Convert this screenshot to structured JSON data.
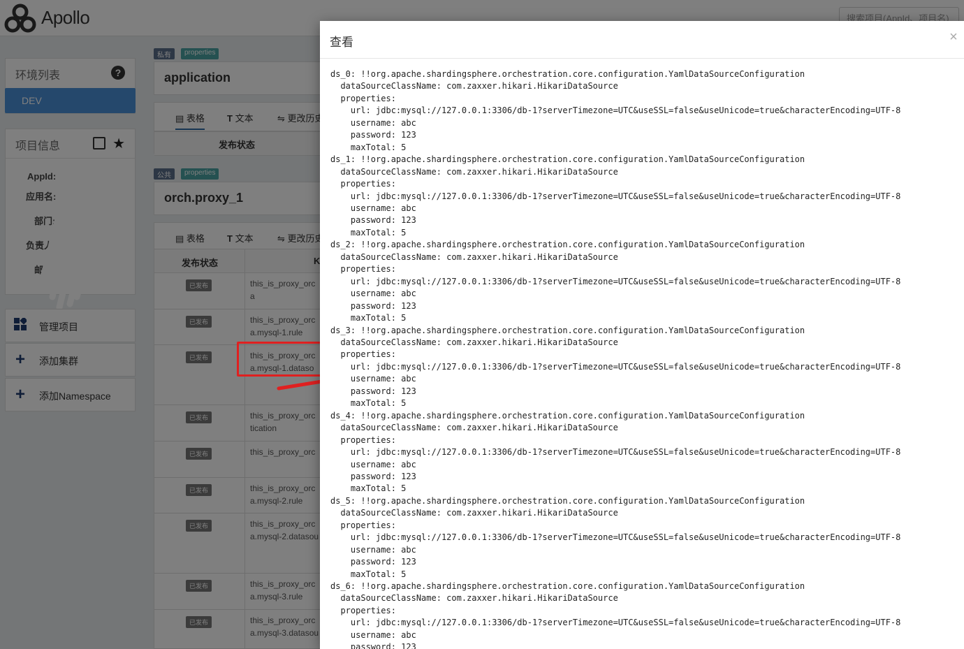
{
  "app": {
    "name": "Apollo"
  },
  "search": {
    "placeholder": "搜索项目(AppId、项目名)"
  },
  "sidebar": {
    "env_title": "环境列表",
    "env_items": [
      "DEV"
    ],
    "project_info_title": "项目信息",
    "info_labels": [
      "AppId:",
      "应用名:",
      "部门:",
      "负责人",
      "邮"
    ],
    "actions": [
      {
        "label": "管理项目",
        "icon": "grid-icon"
      },
      {
        "label": "添加集群",
        "icon": "plus-icon"
      },
      {
        "label": "添加Namespace",
        "icon": "plus-icon"
      }
    ]
  },
  "namespaces": [
    {
      "badge_scope": "私有",
      "badge_format": "properties",
      "title": "application",
      "tabs": [
        "表格",
        "文本",
        "更改历史"
      ],
      "column_status": "发布状态"
    },
    {
      "badge_scope": "公共",
      "badge_format": "properties",
      "title": "orch.proxy_1",
      "tabs": [
        "表格",
        "文本",
        "更改历史"
      ],
      "column_status": "发布状态",
      "column_key": "K"
    }
  ],
  "rows": [
    {
      "status": "已发布",
      "key1": "this_is_proxy_orc",
      "key2": "a"
    },
    {
      "status": "已发布",
      "key1": "this_is_proxy_orc",
      "key2": "a.mysql-1.rule"
    },
    {
      "status": "已发布",
      "key1": "this_is_proxy_orc",
      "key2": "a.mysql-1.dataso"
    },
    {
      "status": "已发布",
      "key1": "this_is_proxy_orc",
      "key2": "tication"
    },
    {
      "status": "已发布",
      "key1": "this_is_proxy_orc",
      "key2": ""
    },
    {
      "status": "已发布",
      "key1": "this_is_proxy_orc",
      "key2": "a.mysql-2.rule"
    },
    {
      "status": "已发布",
      "key1": "this_is_proxy_orc",
      "key2": "a.mysql-2.datasou"
    },
    {
      "status": "已发布",
      "key1": "this_is_proxy_orc",
      "key2": "a.mysql-3.rule"
    },
    {
      "status": "已发布",
      "key1": "this_is_proxy_orc",
      "key2": "a.mysql-3.datasou"
    }
  ],
  "modal": {
    "title": "查看",
    "close": "×",
    "lines": [
      "ds_0: !!org.apache.shardingsphere.orchestration.core.configuration.YamlDataSourceConfiguration",
      "  dataSourceClassName: com.zaxxer.hikari.HikariDataSource",
      "  properties:",
      "    url: jdbc:mysql://127.0.0.1:3306/db-1?serverTimezone=UTC&useSSL=false&useUnicode=true&characterEncoding=UTF-8",
      "    username: abc",
      "    password: 123",
      "    maxTotal: 5",
      "ds_1: !!org.apache.shardingsphere.orchestration.core.configuration.YamlDataSourceConfiguration",
      "  dataSourceClassName: com.zaxxer.hikari.HikariDataSource",
      "  properties:",
      "    url: jdbc:mysql://127.0.0.1:3306/db-1?serverTimezone=UTC&useSSL=false&useUnicode=true&characterEncoding=UTF-8",
      "    username: abc",
      "    password: 123",
      "    maxTotal: 5",
      "ds_2: !!org.apache.shardingsphere.orchestration.core.configuration.YamlDataSourceConfiguration",
      "  dataSourceClassName: com.zaxxer.hikari.HikariDataSource",
      "  properties:",
      "    url: jdbc:mysql://127.0.0.1:3306/db-1?serverTimezone=UTC&useSSL=false&useUnicode=true&characterEncoding=UTF-8",
      "    username: abc",
      "    password: 123",
      "    maxTotal: 5",
      "ds_3: !!org.apache.shardingsphere.orchestration.core.configuration.YamlDataSourceConfiguration",
      "  dataSourceClassName: com.zaxxer.hikari.HikariDataSource",
      "  properties:",
      "    url: jdbc:mysql://127.0.0.1:3306/db-1?serverTimezone=UTC&useSSL=false&useUnicode=true&characterEncoding=UTF-8",
      "    username: abc",
      "    password: 123",
      "    maxTotal: 5",
      "ds_4: !!org.apache.shardingsphere.orchestration.core.configuration.YamlDataSourceConfiguration",
      "  dataSourceClassName: com.zaxxer.hikari.HikariDataSource",
      "  properties:",
      "    url: jdbc:mysql://127.0.0.1:3306/db-1?serverTimezone=UTC&useSSL=false&useUnicode=true&characterEncoding=UTF-8",
      "    username: abc",
      "    password: 123",
      "    maxTotal: 5",
      "ds_5: !!org.apache.shardingsphere.orchestration.core.configuration.YamlDataSourceConfiguration",
      "  dataSourceClassName: com.zaxxer.hikari.HikariDataSource",
      "  properties:",
      "    url: jdbc:mysql://127.0.0.1:3306/db-1?serverTimezone=UTC&useSSL=false&useUnicode=true&characterEncoding=UTF-8",
      "    username: abc",
      "    password: 123",
      "    maxTotal: 5",
      "ds_6: !!org.apache.shardingsphere.orchestration.core.configuration.YamlDataSourceConfiguration",
      "  dataSourceClassName: com.zaxxer.hikari.HikariDataSource",
      "  properties:",
      "    url: jdbc:mysql://127.0.0.1:3306/db-1?serverTimezone=UTC&useSSL=false&useUnicode=true&characterEncoding=UTF-8",
      "    username: abc",
      "    password: 123"
    ]
  },
  "colors": {
    "env_active": "#4a90d9",
    "badge_private": "#5a6f8a",
    "badge_public": "#5a6f8a",
    "badge_properties": "#4aa3a3",
    "highlight": "#e02020"
  }
}
